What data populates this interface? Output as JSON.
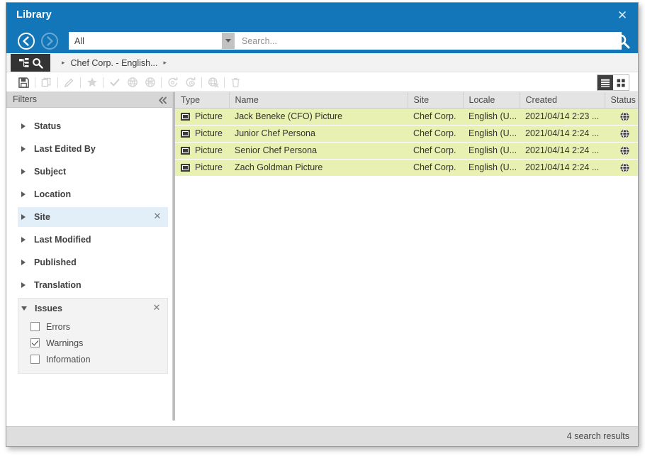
{
  "window": {
    "title": "Library",
    "close_label": "✕",
    "accent_color": "#1276b8",
    "row_highlight_color": "#e8f0b2"
  },
  "navbar": {
    "back_icon": "arrow-left-circle-icon",
    "forward_icon": "arrow-right-circle-icon",
    "scope_value": "All",
    "scope_options": [
      "All"
    ],
    "search_value": "",
    "search_placeholder": "Search...",
    "search_button_icon": "search-icon"
  },
  "breadcrumb": {
    "tree_icon": "tree-view-icon",
    "search_icon": "search-icon",
    "separator": "▸",
    "items": [
      "Chef Corp. - English..."
    ]
  },
  "toolbar": {
    "buttons": [
      {
        "name": "save-button",
        "icon": "save-icon",
        "enabled": true
      },
      {
        "name": "copy-button",
        "icon": "copy-icon",
        "enabled": false
      },
      {
        "name": "edit-button",
        "icon": "pencil-icon",
        "enabled": false
      },
      {
        "name": "favorite-button",
        "icon": "star-icon",
        "enabled": false
      },
      {
        "name": "approve-button",
        "icon": "check-icon",
        "enabled": false
      },
      {
        "name": "publish-button",
        "icon": "publish-icon",
        "enabled": false
      },
      {
        "name": "unpublish-button",
        "icon": "unpublish-icon",
        "enabled": false
      },
      {
        "name": "refresh-button",
        "icon": "refresh-icon",
        "enabled": false
      },
      {
        "name": "schedule-button",
        "icon": "clock-refresh-icon",
        "enabled": false
      },
      {
        "name": "cancel-publish-button",
        "icon": "publish-cancel-icon",
        "enabled": false
      },
      {
        "name": "delete-button",
        "icon": "trash-icon",
        "enabled": false
      }
    ],
    "view_toggles": [
      {
        "name": "list-view-toggle",
        "icon": "list-view-icon",
        "active": true
      },
      {
        "name": "tile-view-toggle",
        "icon": "tile-view-icon",
        "active": false
      }
    ]
  },
  "filters": {
    "header": "Filters",
    "collapse_icon": "chevron-double-left-icon",
    "groups": [
      {
        "label": "Status",
        "expanded": false,
        "highlighted": false,
        "clearable": false
      },
      {
        "label": "Last Edited By",
        "expanded": false,
        "highlighted": false,
        "clearable": false
      },
      {
        "label": "Subject",
        "expanded": false,
        "highlighted": false,
        "clearable": false
      },
      {
        "label": "Location",
        "expanded": false,
        "highlighted": false,
        "clearable": false
      },
      {
        "label": "Site",
        "expanded": false,
        "highlighted": true,
        "clearable": true
      },
      {
        "label": "Last Modified",
        "expanded": false,
        "highlighted": false,
        "clearable": false
      },
      {
        "label": "Published",
        "expanded": false,
        "highlighted": false,
        "clearable": false
      },
      {
        "label": "Translation",
        "expanded": false,
        "highlighted": false,
        "clearable": false
      }
    ],
    "issues": {
      "label": "Issues",
      "expanded": true,
      "clearable": true,
      "clear_label": "✕",
      "options": [
        {
          "label": "Errors",
          "checked": false
        },
        {
          "label": "Warnings",
          "checked": true
        },
        {
          "label": "Information",
          "checked": false
        }
      ]
    }
  },
  "results": {
    "columns": [
      "Type",
      "Name",
      "Site",
      "Locale",
      "Created",
      "Status"
    ],
    "rows": [
      {
        "type": "Picture",
        "type_icon": "picture-icon",
        "name": "Jack Beneke (CFO) Picture",
        "site": "Chef Corp.",
        "locale": "English (U...",
        "created": "2021/04/14 2:23 ...",
        "status_icon": "globe-status-icon"
      },
      {
        "type": "Picture",
        "type_icon": "picture-icon",
        "name": "Junior Chef Persona",
        "site": "Chef Corp.",
        "locale": "English (U...",
        "created": "2021/04/14 2:24 ...",
        "status_icon": "globe-status-icon"
      },
      {
        "type": "Picture",
        "type_icon": "picture-icon",
        "name": "Senior Chef Persona",
        "site": "Chef Corp.",
        "locale": "English (U...",
        "created": "2021/04/14 2:24 ...",
        "status_icon": "globe-status-icon"
      },
      {
        "type": "Picture",
        "type_icon": "picture-icon",
        "name": "Zach Goldman Picture",
        "site": "Chef Corp.",
        "locale": "English (U...",
        "created": "2021/04/14 2:24 ...",
        "status_icon": "globe-status-icon"
      }
    ]
  },
  "statusbar": {
    "text": "4 search results"
  }
}
